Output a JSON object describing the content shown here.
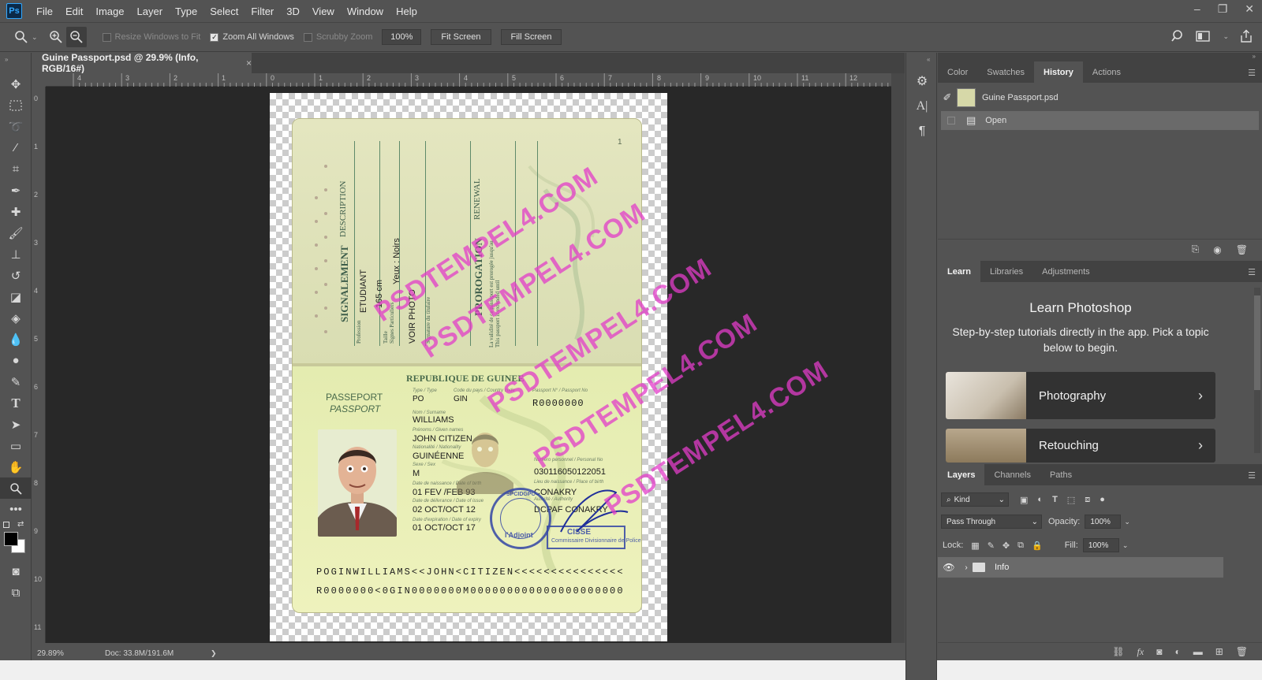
{
  "app": {
    "logo": "Ps"
  },
  "menu": [
    "File",
    "Edit",
    "Image",
    "Layer",
    "Type",
    "Select",
    "Filter",
    "3D",
    "View",
    "Window",
    "Help"
  ],
  "window_controls": {
    "minimize": "–",
    "restore": "❐",
    "close": "✕"
  },
  "options": {
    "resize_windows": "Resize Windows to Fit",
    "zoom_all": "Zoom All Windows",
    "scrubby": "Scrubby Zoom",
    "zoom_value": "100%",
    "fit_screen": "Fit Screen",
    "fill_screen": "Fill Screen"
  },
  "document": {
    "tab_title": "Guine Passport.psd @ 29.9% (Info, RGB/16#)",
    "close": "×",
    "zoom_status": "29.89%",
    "doc_size": "Doc: 33.8M/191.6M",
    "status_arrow": "❯"
  },
  "rulers": {
    "horizontal": [
      "4",
      "3",
      "2",
      "1",
      "0",
      "1",
      "2",
      "3",
      "4",
      "5",
      "6",
      "7",
      "8",
      "9",
      "10",
      "11",
      "12"
    ],
    "vertical": [
      "0",
      "1",
      "2",
      "3",
      "4",
      "5",
      "6",
      "7",
      "8",
      "9",
      "10",
      "11"
    ]
  },
  "passport": {
    "top": {
      "signalement": "SIGNALEMENT",
      "description": "DESCRIPTION",
      "profession_lbl": "Profession",
      "etudiant": "ETUDIANT",
      "taille_lbl": "Taille",
      "taille": "165 cm",
      "signes_lbl": "Signes Particuliers",
      "yeux": "Yeux : Noirs",
      "voir_photo": "VOIR PHOTO",
      "signature_lbl": "Signature du titulaire",
      "prorogation": "PROROGATION",
      "renewal": "RENEWAL",
      "validity": "La validité de ce passeport est prorogée jusqu'au",
      "validity2": "This passport is extended until",
      "page_num": "1"
    },
    "bottom": {
      "republic": "REPUBLIQUE DE GUINEE",
      "passeport": "PASSEPORT",
      "passport": "PASSPORT",
      "type_lbl": "Type / Type",
      "type": "PO",
      "country_lbl": "Code du pays / Country code",
      "country": "GIN",
      "number_lbl": "Passport N° / Passport No",
      "number": "R0000000",
      "surname_lbl": "Nom / Surname",
      "surname": "WILLIAMS",
      "given_lbl": "Prénoms / Given names",
      "given": "JOHN CITIZEN",
      "nationality_lbl": "Nationalité / Nationality",
      "nationality": "GUINÉENNE",
      "sex_lbl": "Sexe / Sex",
      "sex": "M",
      "personal_lbl": "Numéro personnel / Personal No",
      "personal": "030116050122051",
      "dob_lbl": "Date de naissance / Date of birth",
      "dob": "01 FEV /FEB 93",
      "pob_lbl": "Lieu de naissance / Place of birth",
      "pob": "CONAKRY",
      "issue_lbl": "Date de délivrance / Date of issue",
      "issue": "02 OCT/OCT 12",
      "authority_lbl": "Autorité / Authority",
      "authority": "DCPAF CONAKRY",
      "expiry_lbl": "Date d'expiration / Date of expiry",
      "expiry": "01 OCT/OCT 17",
      "stamp_text": "l'Adjoint",
      "stamp_ring": "SPCIDGPC",
      "sign_box": "Commissaire Divisionnaire de Police",
      "sign_name": "CISSE",
      "mrz1": "POGINWILLIAMS<<JOHN<CITIZEN<<<<<<<<<<<<<<<",
      "mrz2": "R0000000<0GIN0000000M000000000000000000000"
    }
  },
  "watermarks": [
    "PSDTEMPEL4.COM",
    "PSDTEMPEL4.COM",
    "PSDTEMPEL4.COM",
    "PSDTEMPEL4.COM",
    "PSDTEMPEL4.COM"
  ],
  "history_panel": {
    "tabs": [
      "Color",
      "Swatches",
      "History",
      "Actions"
    ],
    "active_tab": "History",
    "snapshot": "Guine Passport.psd",
    "states": [
      "Open"
    ]
  },
  "learn_panel": {
    "tabs": [
      "Learn",
      "Libraries",
      "Adjustments"
    ],
    "active_tab": "Learn",
    "title": "Learn Photoshop",
    "subtitle": "Step-by-step tutorials directly in the app. Pick a topic below to begin.",
    "cards": [
      "Photography",
      "Retouching"
    ]
  },
  "layers_panel": {
    "tabs": [
      "Layers",
      "Channels",
      "Paths"
    ],
    "active_tab": "Layers",
    "filter": "Kind",
    "blend_mode": "Pass Through",
    "opacity_label": "Opacity:",
    "opacity": "100%",
    "lock_label": "Lock:",
    "fill_label": "Fill:",
    "fill": "100%",
    "layers": [
      {
        "name": "Info",
        "type": "group",
        "visible": true
      }
    ],
    "footer_fx": "fx"
  },
  "colors": {
    "accent": "#31a8ff",
    "watermark": "#e23cc8",
    "bg": "#535353",
    "canvas": "#282828"
  }
}
